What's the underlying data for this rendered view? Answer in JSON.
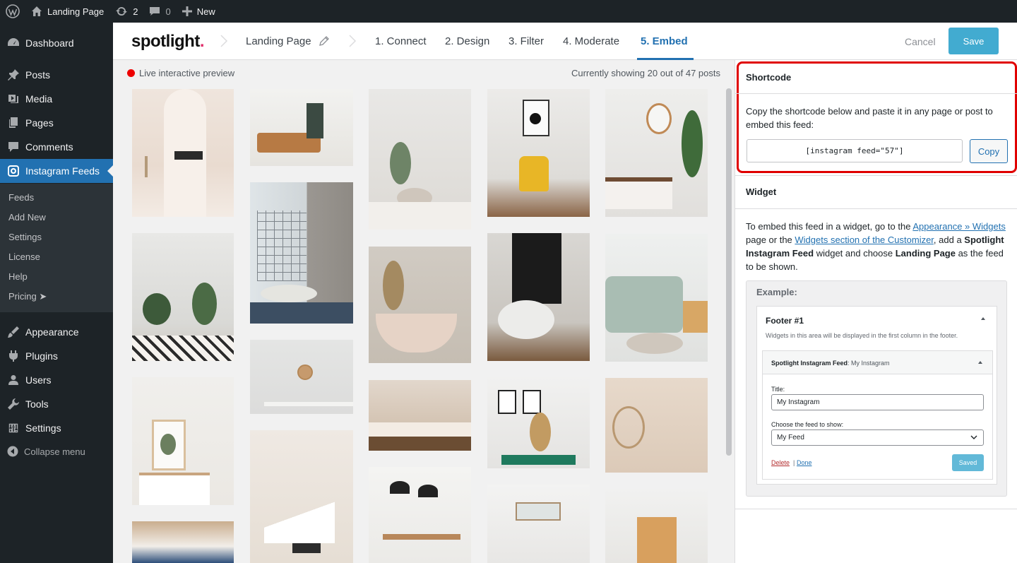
{
  "adminbar": {
    "site_name": "Landing Page",
    "updates_count": "2",
    "comments_count": "0",
    "new_label": "New"
  },
  "sidebar": {
    "items": [
      {
        "label": "Dashboard",
        "icon": "dashboard-icon"
      },
      {
        "label": "Posts",
        "icon": "pin-icon"
      },
      {
        "label": "Media",
        "icon": "media-icon"
      },
      {
        "label": "Pages",
        "icon": "pages-icon"
      },
      {
        "label": "Comments",
        "icon": "comment-icon"
      },
      {
        "label": "Instagram Feeds",
        "icon": "instagram-icon",
        "active": true
      },
      {
        "label": "Appearance",
        "icon": "brush-icon"
      },
      {
        "label": "Plugins",
        "icon": "plugin-icon"
      },
      {
        "label": "Users",
        "icon": "user-icon"
      },
      {
        "label": "Tools",
        "icon": "wrench-icon"
      },
      {
        "label": "Settings",
        "icon": "settings-icon"
      }
    ],
    "submenu": [
      "Feeds",
      "Add New",
      "Settings",
      "License",
      "Help",
      "Pricing ➤"
    ],
    "collapse_label": "Collapse menu"
  },
  "topnav": {
    "logo": "spotlight",
    "logo_dot": ".",
    "feed_name": "Landing Page",
    "steps": [
      "1. Connect",
      "2. Design",
      "3. Filter",
      "4. Moderate",
      "5. Embed"
    ],
    "active_step": "5. Embed",
    "cancel_label": "Cancel",
    "save_label": "Save"
  },
  "preview": {
    "live_label": "Live interactive preview",
    "showing_text": "Currently showing 20 out of 47 posts"
  },
  "shortcode": {
    "title": "Shortcode",
    "description": "Copy the shortcode below and paste it in any page or post to embed this feed:",
    "code": "[instagram feed=\"57\"]",
    "copy_label": "Copy"
  },
  "widget": {
    "title": "Widget",
    "desc_1": "To embed this feed in a widget, go to the ",
    "link_appearance": "Appearance » Widgets",
    "desc_2": " page or the ",
    "link_customizer": "Widgets section of the Customizer",
    "desc_3": ", add a ",
    "bold_widget": "Spotlight Instagram Feed",
    "desc_4": " widget and choose ",
    "bold_feed": "Landing Page",
    "desc_5": " as the feed to be shown.",
    "example": {
      "label": "Example:",
      "footer_title": "Footer #1",
      "footer_desc": "Widgets in this area will be displayed in the first column in the footer.",
      "widget_name": "Spotlight Instagram Feed",
      "widget_suffix": ": My Instagram",
      "title_label": "Title:",
      "title_value": "My Instagram",
      "feed_label": "Choose the feed to show:",
      "feed_value": "My Feed",
      "delete_label": "Delete",
      "separator": "|",
      "done_label": "Done",
      "saved_label": "Saved"
    }
  },
  "colors": {
    "wp_dark": "#1d2327",
    "wp_blue": "#2271b1",
    "highlight_red": "#e00000",
    "save_blue": "#2ea2cc"
  }
}
